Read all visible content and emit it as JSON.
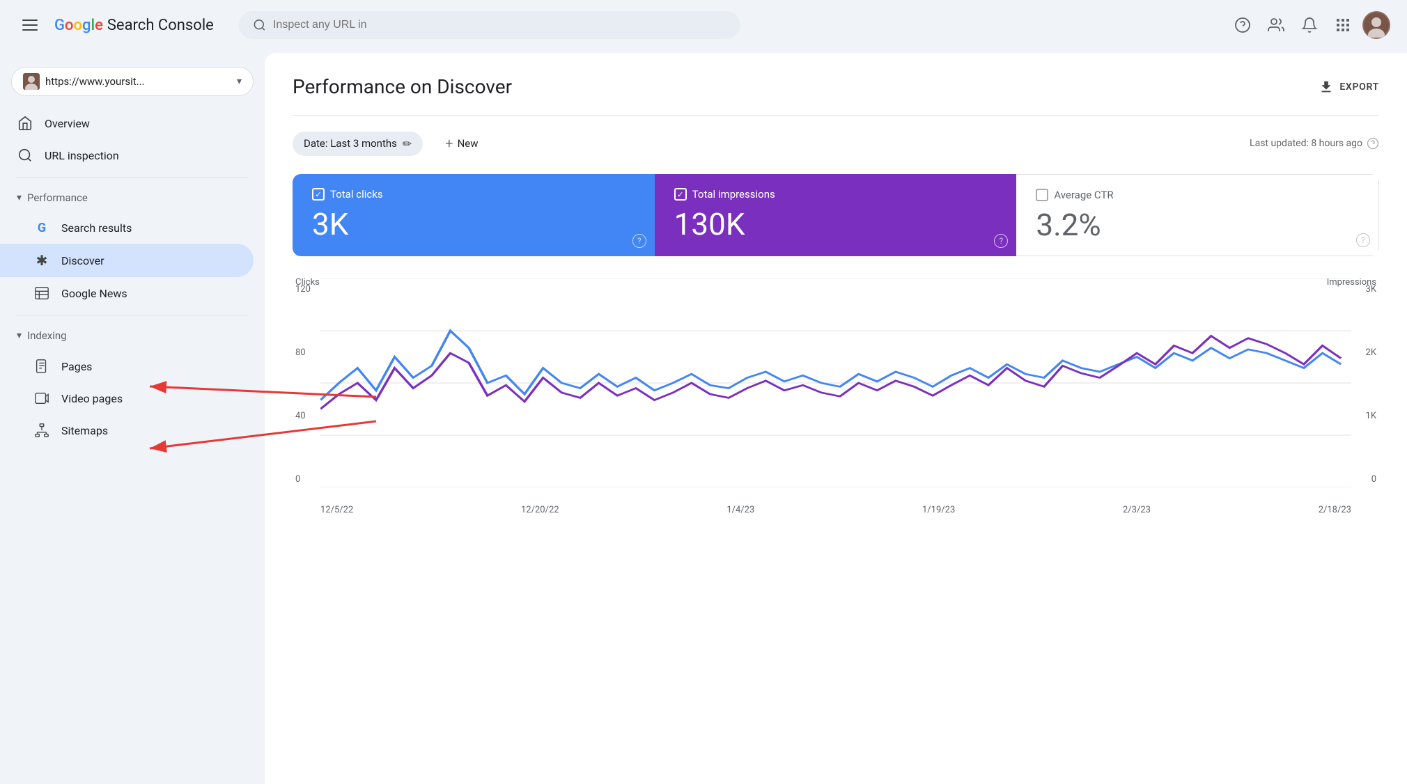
{
  "header": {
    "logo_google": "Google",
    "logo_search_console": "Search Console",
    "search_placeholder": "Inspect any URL in",
    "hamburger_label": "Menu"
  },
  "site_selector": {
    "url": "https://www.yoursit...",
    "favicon_alt": "site favicon"
  },
  "sidebar": {
    "overview_label": "Overview",
    "url_inspection_label": "URL inspection",
    "performance_label": "Performance",
    "search_results_label": "Search results",
    "discover_label": "Discover",
    "google_news_label": "Google News",
    "indexing_label": "Indexing",
    "pages_label": "Pages",
    "video_pages_label": "Video pages",
    "sitemaps_label": "Sitemaps"
  },
  "content": {
    "page_title": "Performance on Discover",
    "export_label": "EXPORT",
    "date_filter_label": "Date: Last 3 months",
    "new_label": "New",
    "last_updated": "Last updated: 8 hours ago"
  },
  "metrics": {
    "total_clicks_label": "Total clicks",
    "total_clicks_value": "3K",
    "total_impressions_label": "Total impressions",
    "total_impressions_value": "130K",
    "avg_ctr_label": "Average CTR",
    "avg_ctr_value": "3.2%"
  },
  "chart": {
    "axis_left_title": "Clicks",
    "axis_right_title": "Impressions",
    "left_labels": [
      "120",
      "80",
      "40",
      "0"
    ],
    "right_labels": [
      "3K",
      "2K",
      "1K",
      "0"
    ],
    "x_labels": [
      "12/5/22",
      "12/20/22",
      "1/4/23",
      "1/19/23",
      "2/3/23",
      "2/18/23"
    ]
  },
  "icons": {
    "search": "🔍",
    "help": "?",
    "people": "👥",
    "bell": "🔔",
    "apps": "⠿",
    "home": "⌂",
    "magnify": "🔍",
    "asterisk": "✱",
    "news": "📰",
    "pages": "📄",
    "video": "📹",
    "sitemap": "📊",
    "download": "⬇",
    "pencil": "✏",
    "plus": "+",
    "chevron_down": "▾",
    "chevron_left": "◀",
    "question": "?"
  },
  "colors": {
    "blue_card": "#4285f4",
    "purple_card": "#7b2fbe",
    "blue_line": "#4285f4",
    "purple_line": "#7b2fbe",
    "active_nav": "#d3e3fd"
  }
}
